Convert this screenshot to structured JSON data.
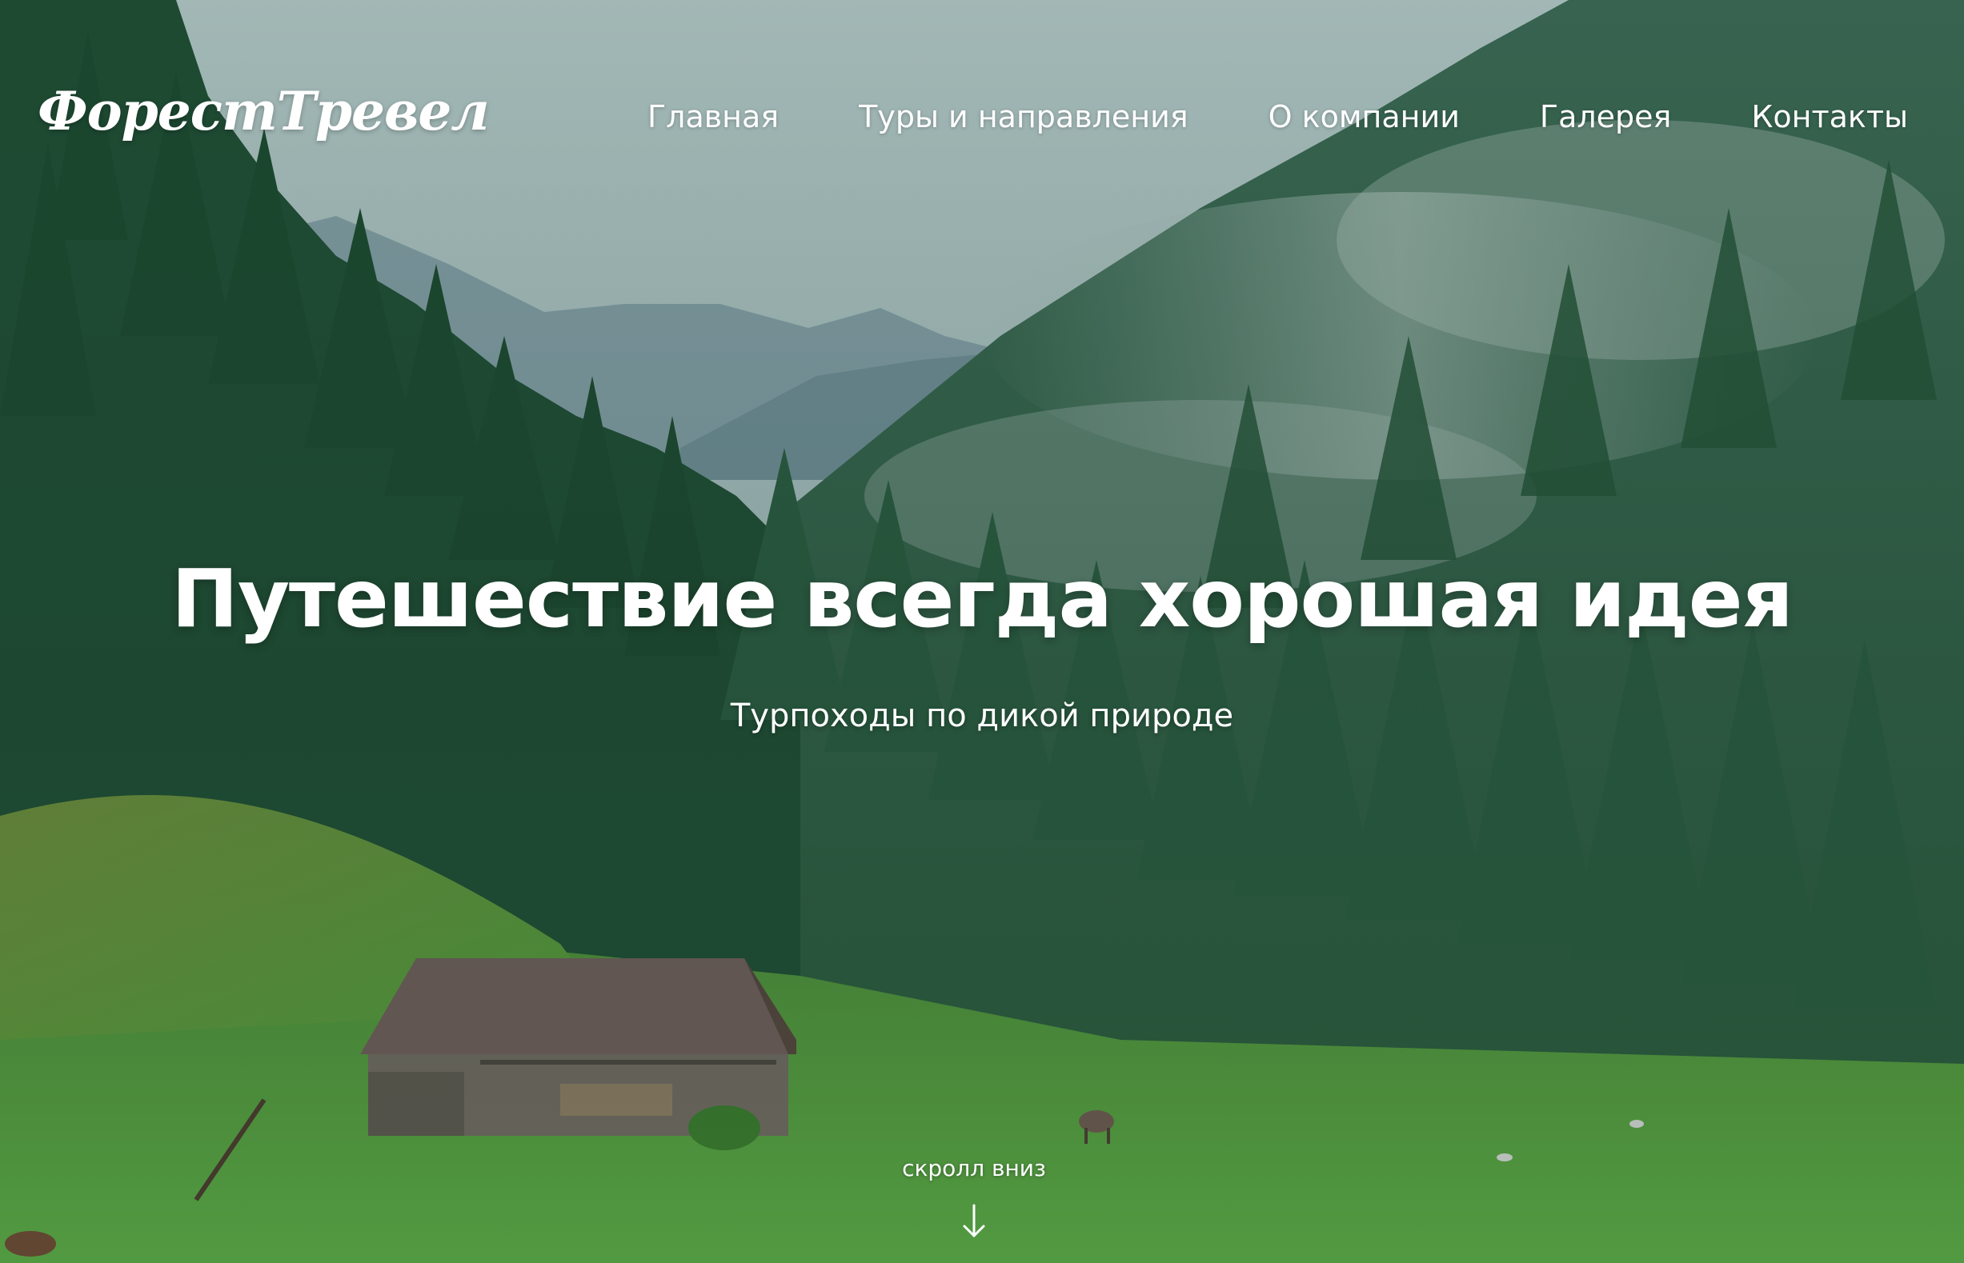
{
  "header": {
    "logo_text": "ФорестТревел",
    "nav": [
      {
        "label": "Главная"
      },
      {
        "label": "Туры и направления"
      },
      {
        "label": "О компании"
      },
      {
        "label": "Галерея"
      },
      {
        "label": "Контакты"
      }
    ]
  },
  "hero": {
    "title": "Путешествие всегда хорошая идея",
    "subtitle": "Турпоходы по дикой природе",
    "scroll_label": "скролл вниз",
    "scroll_icon": "arrow-down-icon"
  },
  "colors": {
    "sky": "#a9c1c0",
    "mountains": "#7f9ca6",
    "forest_dark": "#1f4a33",
    "forest_mid": "#3f6e55",
    "meadow": "#4f9b3c",
    "text": "#ffffff"
  }
}
